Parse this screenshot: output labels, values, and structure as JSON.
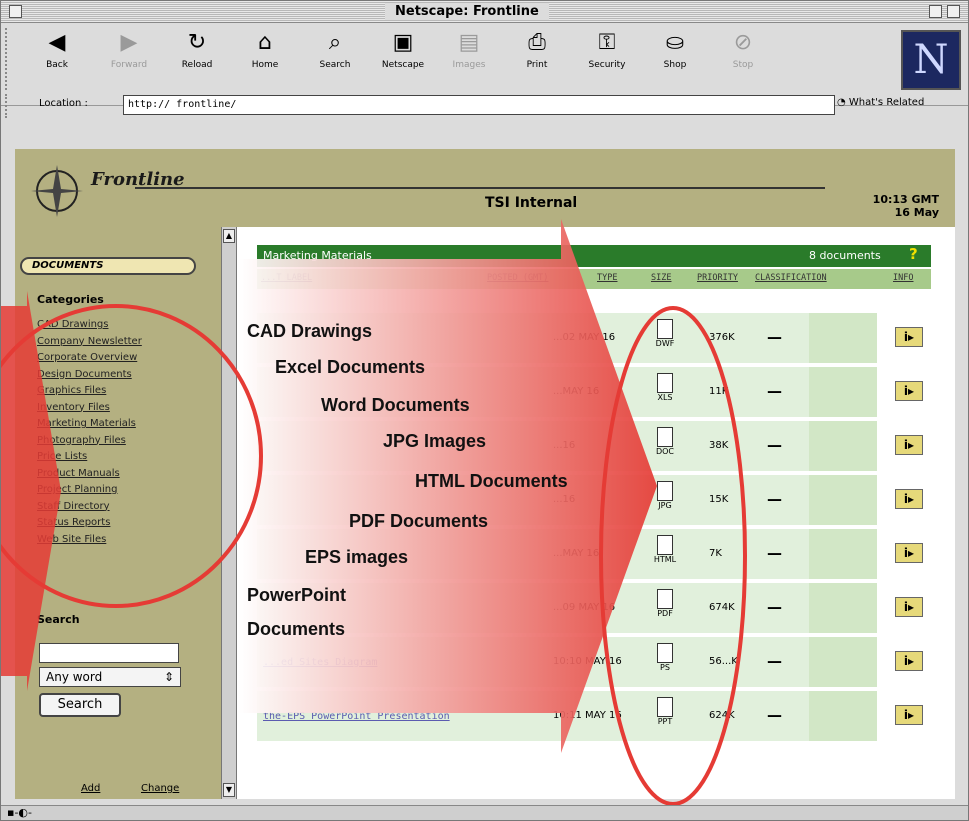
{
  "window": {
    "title": "Netscape: Frontline"
  },
  "toolbar": {
    "buttons": [
      {
        "label": "Back",
        "enabled": true
      },
      {
        "label": "Forward",
        "enabled": false
      },
      {
        "label": "Reload",
        "enabled": true
      },
      {
        "label": "Home",
        "enabled": true
      },
      {
        "label": "Search",
        "enabled": true
      },
      {
        "label": "Netscape",
        "enabled": true
      },
      {
        "label": "Images",
        "enabled": false
      },
      {
        "label": "Print",
        "enabled": true
      },
      {
        "label": "Security",
        "enabled": true
      },
      {
        "label": "Shop",
        "enabled": true
      },
      {
        "label": "Stop",
        "enabled": false
      }
    ],
    "logo": "N"
  },
  "location": {
    "label": "Location :",
    "url": "http:// frontline/",
    "related": "What's Related"
  },
  "site": {
    "brand": "Frontline",
    "section": "TSI Internal",
    "time": "10:13 GMT",
    "date": "16 May"
  },
  "sidebar": {
    "documents_button": "DOCUMENTS",
    "categories_heading": "Categories",
    "categories": [
      "CAD Drawings",
      "Company Newsletter",
      "Corporate Overview",
      "Design Documents",
      "Graphics Files",
      "Inventory Files",
      "Marketing Materials",
      "Photography Files",
      "Price Lists",
      "Product Manuals",
      "Project Planning",
      "Staff Directory",
      "Status Reports",
      "Web Site Files"
    ],
    "search_heading": "Search",
    "search_mode": "Any word",
    "search_button": "Search",
    "bottom_links": [
      "Add",
      "Change"
    ]
  },
  "panel": {
    "title": "Marketing Materials",
    "count": "8 documents",
    "help": "?",
    "columns": [
      "...T LABEL",
      "POSTED (GMT)",
      "TYPE",
      "SIZE",
      "PRIORITY",
      "CLASSIFICATION",
      "INFO"
    ],
    "rows": [
      {
        "label": "",
        "posted": "...02 MAY 16",
        "type": "DWF",
        "size": "376K",
        "priority": "—",
        "info": "i▸"
      },
      {
        "label": "",
        "posted": "...MAY 16",
        "type": "XLS",
        "size": "11K",
        "priority": "—",
        "info": "i▸"
      },
      {
        "label": "",
        "posted": "...16",
        "type": "DOC",
        "size": "38K",
        "priority": "—",
        "info": "i▸"
      },
      {
        "label": "",
        "posted": "...16",
        "type": "JPG",
        "size": "15K",
        "priority": "—",
        "info": "i▸"
      },
      {
        "label": "",
        "posted": "...MAY 16",
        "type": "HTML",
        "size": "7K",
        "priority": "—",
        "info": "i▸"
      },
      {
        "label": "",
        "posted": "...09 MAY 16",
        "type": "PDF",
        "size": "674K",
        "priority": "—",
        "info": "i▸"
      },
      {
        "label": "...ed Sites Diagram",
        "posted": "10:10 MAY 16",
        "type": "PS",
        "size": "56...K",
        "priority": "—",
        "info": "i▸"
      },
      {
        "label": "the-EPS PowerPoint Presentation",
        "posted": "10:11 MAY 16",
        "type": "PPT",
        "size": "624K",
        "priority": "—",
        "info": "i▸"
      }
    ]
  },
  "annotations": [
    "CAD Drawings",
    "Excel Documents",
    "Word Documents",
    "JPG Images",
    "HTML Documents",
    "PDF Documents",
    "EPS images",
    "PowerPoint",
    "Documents"
  ],
  "colors": {
    "sidebar": "#b4b081",
    "header_bar": "#2a7b2a",
    "column_bar": "#a7ca8a",
    "row_bg": "#e1f0dc",
    "highlight_ring": "#e53b35"
  }
}
